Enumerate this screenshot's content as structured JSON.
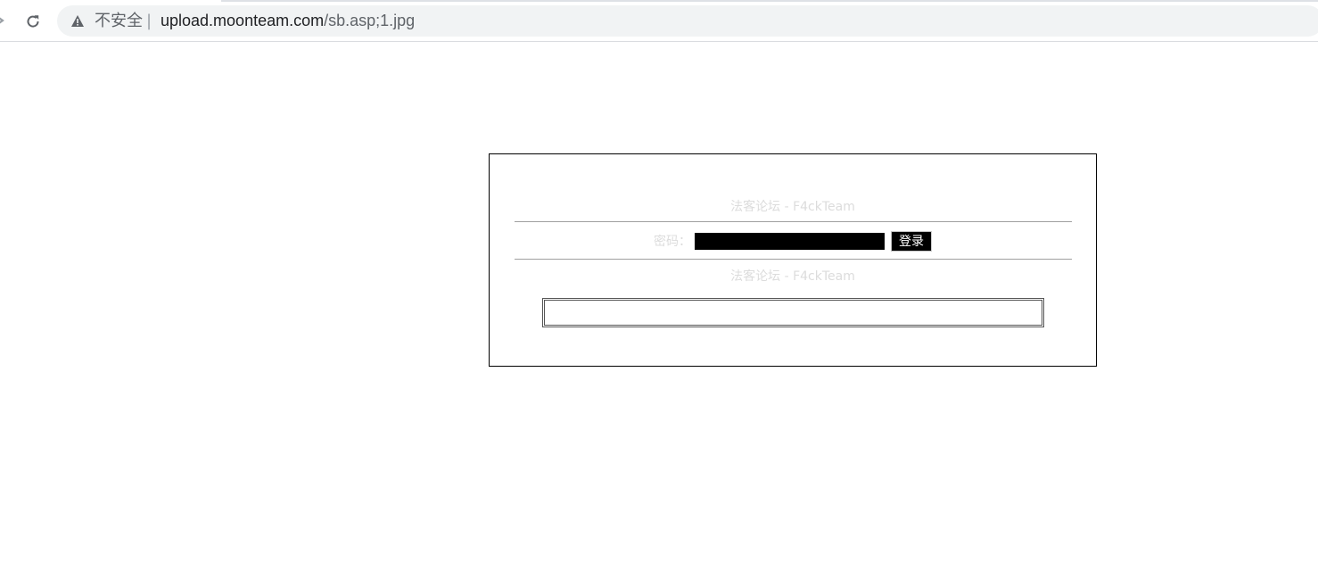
{
  "browser": {
    "security_label": "不安全",
    "separator": "|",
    "url_host": "upload.moonteam.com",
    "url_path": "/sb.asp;1.jpg"
  },
  "login": {
    "title": "法客论坛 - F4ckTeam",
    "password_label": "密码：",
    "password_value": "",
    "login_button": "登录",
    "footer_title": "法客论坛 - F4ckTeam",
    "text_field_value": ""
  },
  "colors": {
    "faded_text": "#dcdcdc",
    "input_background": "#000000",
    "button_background": "#000000",
    "omnibox_background": "#f1f3f4"
  }
}
